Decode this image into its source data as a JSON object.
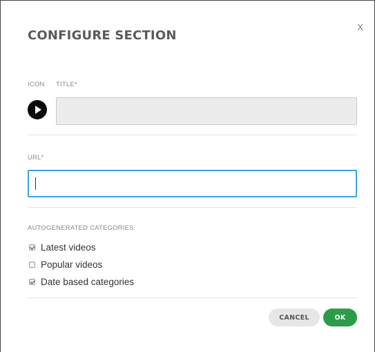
{
  "dialog": {
    "title": "CONFIGURE SECTION",
    "close_label": "X",
    "icon_label": "ICON",
    "title_label": "TITLE",
    "required_mark": "*",
    "title_value": "",
    "url_label": "URL",
    "url_value": "",
    "autogen_label": "AUTOGENERATED CATEGORIES",
    "categories": [
      {
        "label": "Latest videos",
        "checked": true
      },
      {
        "label": "Popular videos",
        "checked": false
      },
      {
        "label": "Date based categories",
        "checked": true
      }
    ],
    "cancel_label": "CANCEL",
    "ok_label": "OK",
    "selected_icon": "play-icon"
  },
  "colors": {
    "ok_button": "#2d9b4a",
    "focus_border": "#37a6d8",
    "cancel_button": "#e6e6e6"
  }
}
